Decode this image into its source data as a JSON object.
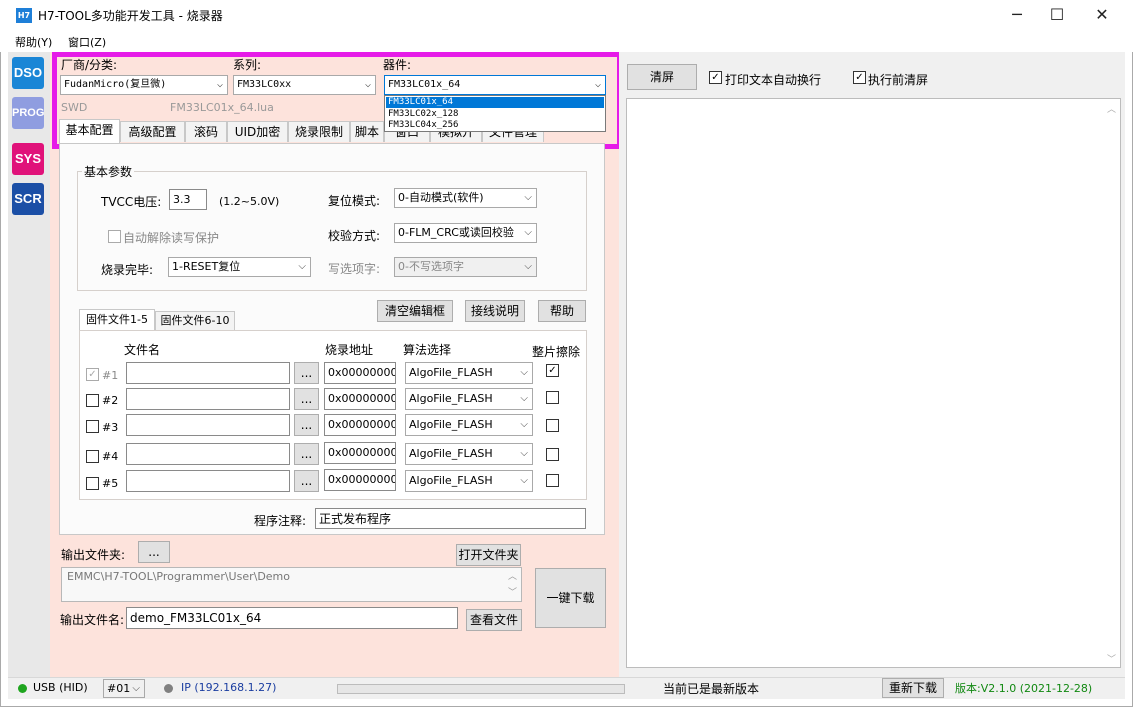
{
  "window": {
    "icon_text": "H7",
    "title": "H7-TOOL多功能开发工具 - 烧录器",
    "minimize": "─",
    "maximize": "☐",
    "close": "✕"
  },
  "menu": {
    "items": [
      "帮助(Y)",
      "窗口(Z)"
    ]
  },
  "sidebar": {
    "tools": [
      {
        "label": "DSO",
        "color": "#1a86d6"
      },
      {
        "label": "PROG",
        "color": "#8f9de0"
      },
      {
        "label": "SYS",
        "color": "#e0127a"
      },
      {
        "label": "SCR",
        "color": "#1b4fa6"
      }
    ]
  },
  "selector": {
    "vendor_label": "厂商/分类:",
    "vendor_value": "FudanMicro(复旦微)",
    "series_label": "系列:",
    "series_value": "FM33LC0xx",
    "device_label": "器件:",
    "device_value": "FM33LC01x_64",
    "interface": "SWD",
    "lua_file": "FM33LC01x_64.lua",
    "device_options": [
      "FM33LC01x_64",
      "FM33LC02x_128",
      "FM33LC04x_256"
    ]
  },
  "tabs": [
    "基本配置",
    "高级配置",
    "滚码",
    "UID加密",
    "烧录限制",
    "脚本",
    "窗口",
    "模拟开",
    "文件管理"
  ],
  "basic": {
    "group_title": "基本参数",
    "tvcc_label": "TVCC电压:",
    "tvcc_value": "3.3",
    "tvcc_range": "(1.2~5.0V)",
    "reset_label": "复位模式:",
    "reset_value": "0-自动模式(软件)",
    "auto_unlock_label": "自动解除读写保护",
    "verify_label": "校验方式:",
    "verify_value": "0-FLM_CRC或读回校验",
    "done_label": "烧录完毕:",
    "done_value": "1-RESET复位",
    "option_label": "写选项字:",
    "option_value": "0-不写选项字"
  },
  "buttons": {
    "clear_edit": "清空编辑框",
    "wiring": "接线说明",
    "help": "帮助"
  },
  "files": {
    "tab1": "固件文件1-5",
    "tab2": "固件文件6-10",
    "col_name": "文件名",
    "col_addr": "烧录地址",
    "col_algo": "算法选择",
    "col_erase": "整片擦除",
    "browse": "...",
    "rows": [
      {
        "id": "#1",
        "addr": "0x00000000",
        "algo": "AlgoFile_FLASH",
        "enabled": "✓",
        "erase": "✓"
      },
      {
        "id": "#2",
        "addr": "0x00000000",
        "algo": "AlgoFile_FLASH",
        "enabled": "",
        "erase": ""
      },
      {
        "id": "#3",
        "addr": "0x00000000",
        "algo": "AlgoFile_FLASH",
        "enabled": "",
        "erase": ""
      },
      {
        "id": "#4",
        "addr": "0x00000000",
        "algo": "AlgoFile_FLASH",
        "enabled": "",
        "erase": ""
      },
      {
        "id": "#5",
        "addr": "0x00000000",
        "algo": "AlgoFile_FLASH",
        "enabled": "",
        "erase": ""
      }
    ],
    "note_label": "程序注释:",
    "note_value": "正式发布程序"
  },
  "output": {
    "folder_label": "输出文件夹:",
    "browse": "...",
    "open_folder": "打开文件夹",
    "path": "EMMC\\H7-TOOL\\Programmer\\User\\Demo",
    "name_label": "输出文件名:",
    "name_value": "demo_FM33LC01x_64",
    "view_file": "查看文件",
    "download": "一键下载"
  },
  "right": {
    "clear": "清屏",
    "wrap_label": "打印文本自动换行",
    "clear_before_label": "执行前清屏"
  },
  "status": {
    "usb": "USB (HID)",
    "device_no": "#01",
    "ip": "IP (192.168.1.27)",
    "latest": "当前已是最新版本",
    "redownload": "重新下载",
    "version": "版本:V2.1.0 (2021-12-28)",
    "usb_color": "#1fa51f",
    "ip_color": "#808080",
    "version_color": "#118811"
  }
}
